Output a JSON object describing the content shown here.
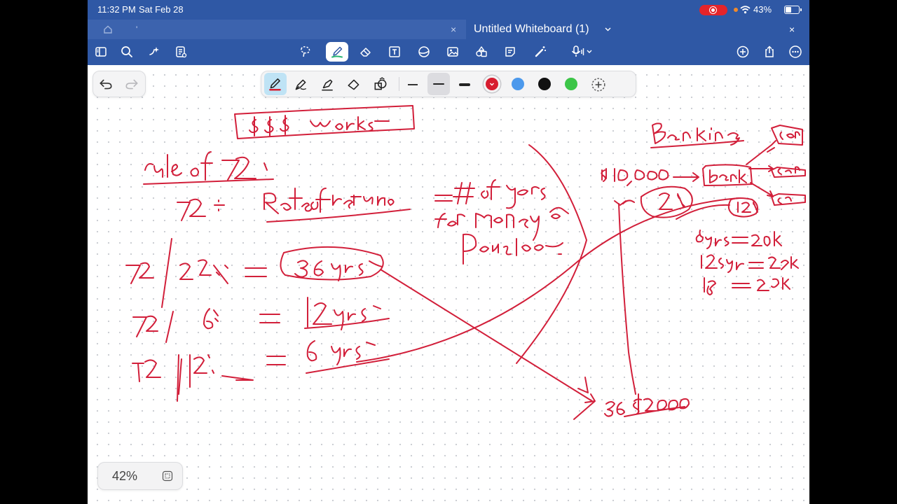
{
  "status_bar": {
    "time": "11:32 PM",
    "date": "Sat Feb 28",
    "battery": "43%"
  },
  "tab_bar": {
    "title": "Untitled Whiteboard (1)",
    "left_tab_text": "'"
  },
  "zoom": {
    "level": "42%"
  },
  "toolbar_icons": [
    "sidebar-icon",
    "search-icon",
    "sparkle-icon",
    "tasks-icon",
    "lasso-icon",
    "pen-icon",
    "eraser-icon",
    "textbox-icon",
    "shapes-icon",
    "image-icon",
    "stickers-icon",
    "note-icon",
    "magic-wand-icon",
    "microphone-icon",
    "add-icon",
    "share-icon",
    "more-icon"
  ],
  "pen_colors": {
    "red": "#d71d2f",
    "blue": "#4c99ec",
    "black": "#111111",
    "green": "#3cc548"
  },
  "ink_color": "#d21f3a"
}
